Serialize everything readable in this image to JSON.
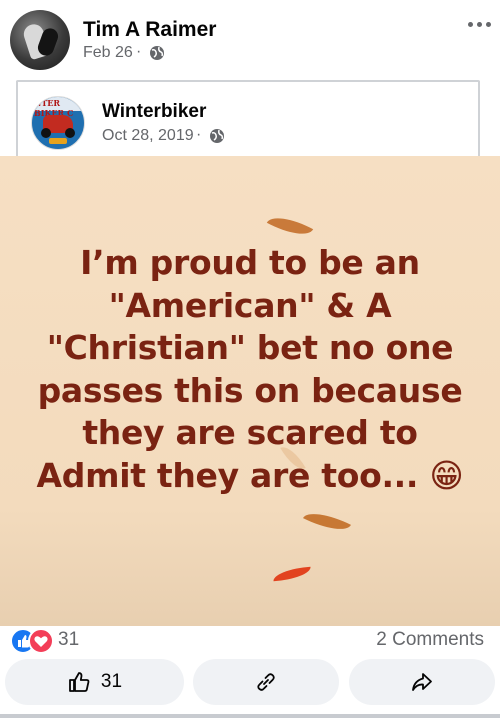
{
  "post": {
    "author": "Tim A Raimer",
    "date": "Feb 26",
    "separator": "·",
    "privacy_icon": "globe-icon",
    "more_icon": "more-options-icon"
  },
  "shared_post": {
    "page_name": "Winterbiker",
    "logo_text": "NTER BIKER C",
    "date": "Oct 28, 2019",
    "separator": "·",
    "privacy_icon": "globe-icon"
  },
  "meme": {
    "lines": [
      "I’m proud to be an",
      "\"American\" & A",
      "\"Christian\" bet no one",
      "passes this on because",
      "they are scared to",
      "Admit they are too... 😁"
    ],
    "text_color": "#7a2312",
    "background_color": "#f6dfc3"
  },
  "reactions": {
    "icons": [
      "like-icon",
      "love-icon"
    ],
    "count": "31",
    "comments": "2 Comments"
  },
  "actions": {
    "like_count": "31",
    "like_icon": "thumbs-up-icon",
    "link_icon": "link-icon",
    "share_icon": "share-arrow-icon"
  },
  "colors": {
    "like_blue": "#1877f2",
    "love_red": "#f33e58",
    "secondary_text": "#65676b",
    "button_bg": "#f0f2f5"
  }
}
